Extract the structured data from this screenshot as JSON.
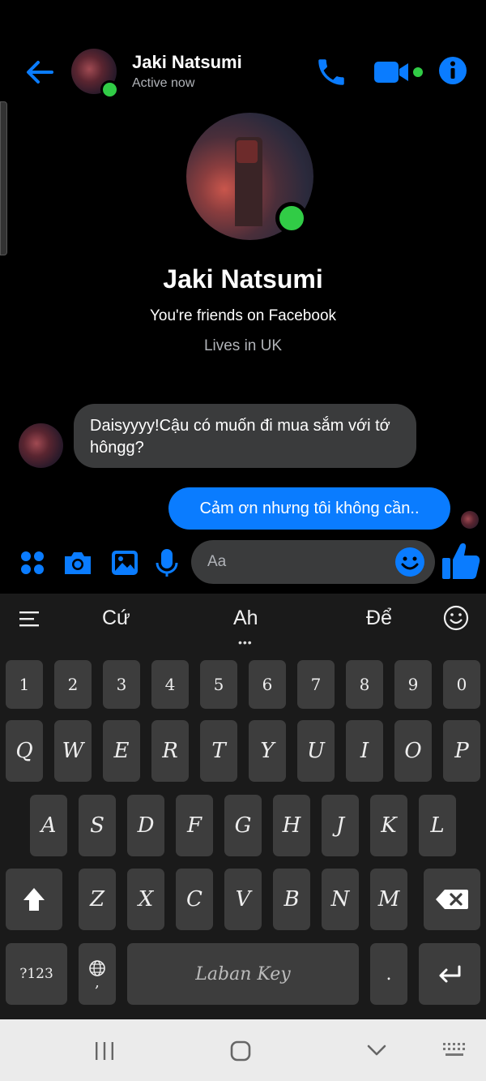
{
  "header": {
    "name": "Jaki Natsumi",
    "status": "Active now"
  },
  "profile": {
    "name": "Jaki Natsumi",
    "friends": "You're friends on Facebook",
    "lives": "Lives in UK"
  },
  "messages": [
    {
      "direction": "incoming",
      "text": "Daisyyyy!Cậu có muốn đi mua sắm với tớ hôngg?"
    },
    {
      "direction": "outgoing",
      "text": "Cảm ơn nhưng tôi không cần.."
    }
  ],
  "composer": {
    "placeholder": "Aa"
  },
  "keyboard": {
    "suggestions": [
      "Cứ",
      "Ah",
      "Để"
    ],
    "row_numbers": [
      "1",
      "2",
      "3",
      "4",
      "5",
      "6",
      "7",
      "8",
      "9",
      "0"
    ],
    "row1": [
      "Q",
      "W",
      "E",
      "R",
      "T",
      "Y",
      "U",
      "I",
      "O",
      "P"
    ],
    "row2": [
      "A",
      "S",
      "D",
      "F",
      "G",
      "H",
      "J",
      "K",
      "L"
    ],
    "row3": [
      "Z",
      "X",
      "C",
      "V",
      "B",
      "N",
      "M"
    ],
    "symbols_label": "?123",
    "comma": ",",
    "space_label": "Laban Key",
    "period": "."
  },
  "colors": {
    "accent": "#0a7cff",
    "online": "#31cc46",
    "incoming_bubble": "#3a3b3c",
    "background": "#000000"
  },
  "icons": [
    "back-arrow-icon",
    "phone-icon",
    "video-icon",
    "info-icon",
    "apps-icon",
    "camera-icon",
    "image-icon",
    "microphone-icon",
    "emoji-icon",
    "like-icon",
    "menu-icon",
    "smiley-icon",
    "shift-icon",
    "backspace-icon",
    "globe-icon",
    "enter-icon",
    "recent-apps-icon",
    "home-icon",
    "back-nav-icon",
    "keyboard-icon"
  ]
}
